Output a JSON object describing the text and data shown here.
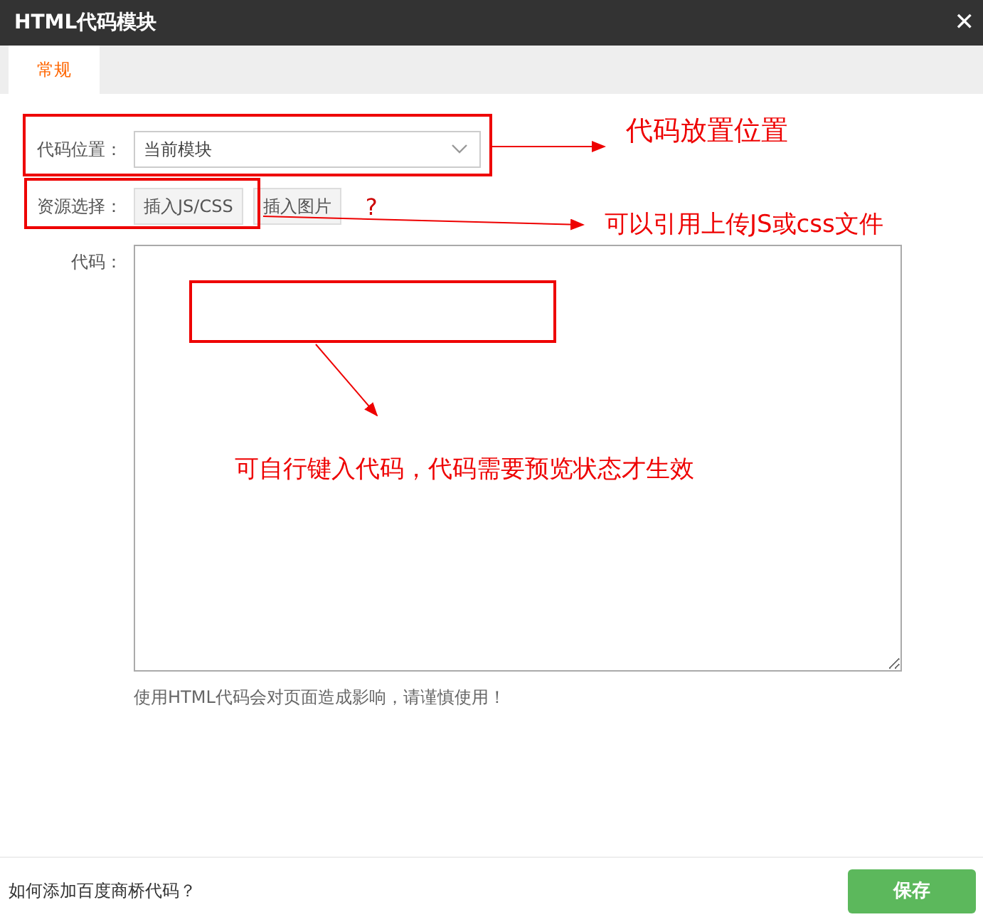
{
  "window": {
    "title": "HTML代码模块",
    "close": "✕"
  },
  "tabs": [
    {
      "label": "常规",
      "selected": true
    }
  ],
  "form": {
    "position_label": "代码位置：",
    "position_value": "当前模块",
    "resource_label": "资源选择：",
    "resource_buttons": [
      "插入JS/CSS",
      "插入图片"
    ],
    "help": "?",
    "code_label": "代码：",
    "hint": "使用HTML代码会对页面造成影响，请谨慎使用！"
  },
  "footer": {
    "link": "如何添加百度商桥代码？",
    "save": "保存"
  },
  "annotations": [
    "代码放置位置",
    "可以引用上传JS或css文件",
    "可自行键入代码，代码需要预览状态才生效"
  ]
}
